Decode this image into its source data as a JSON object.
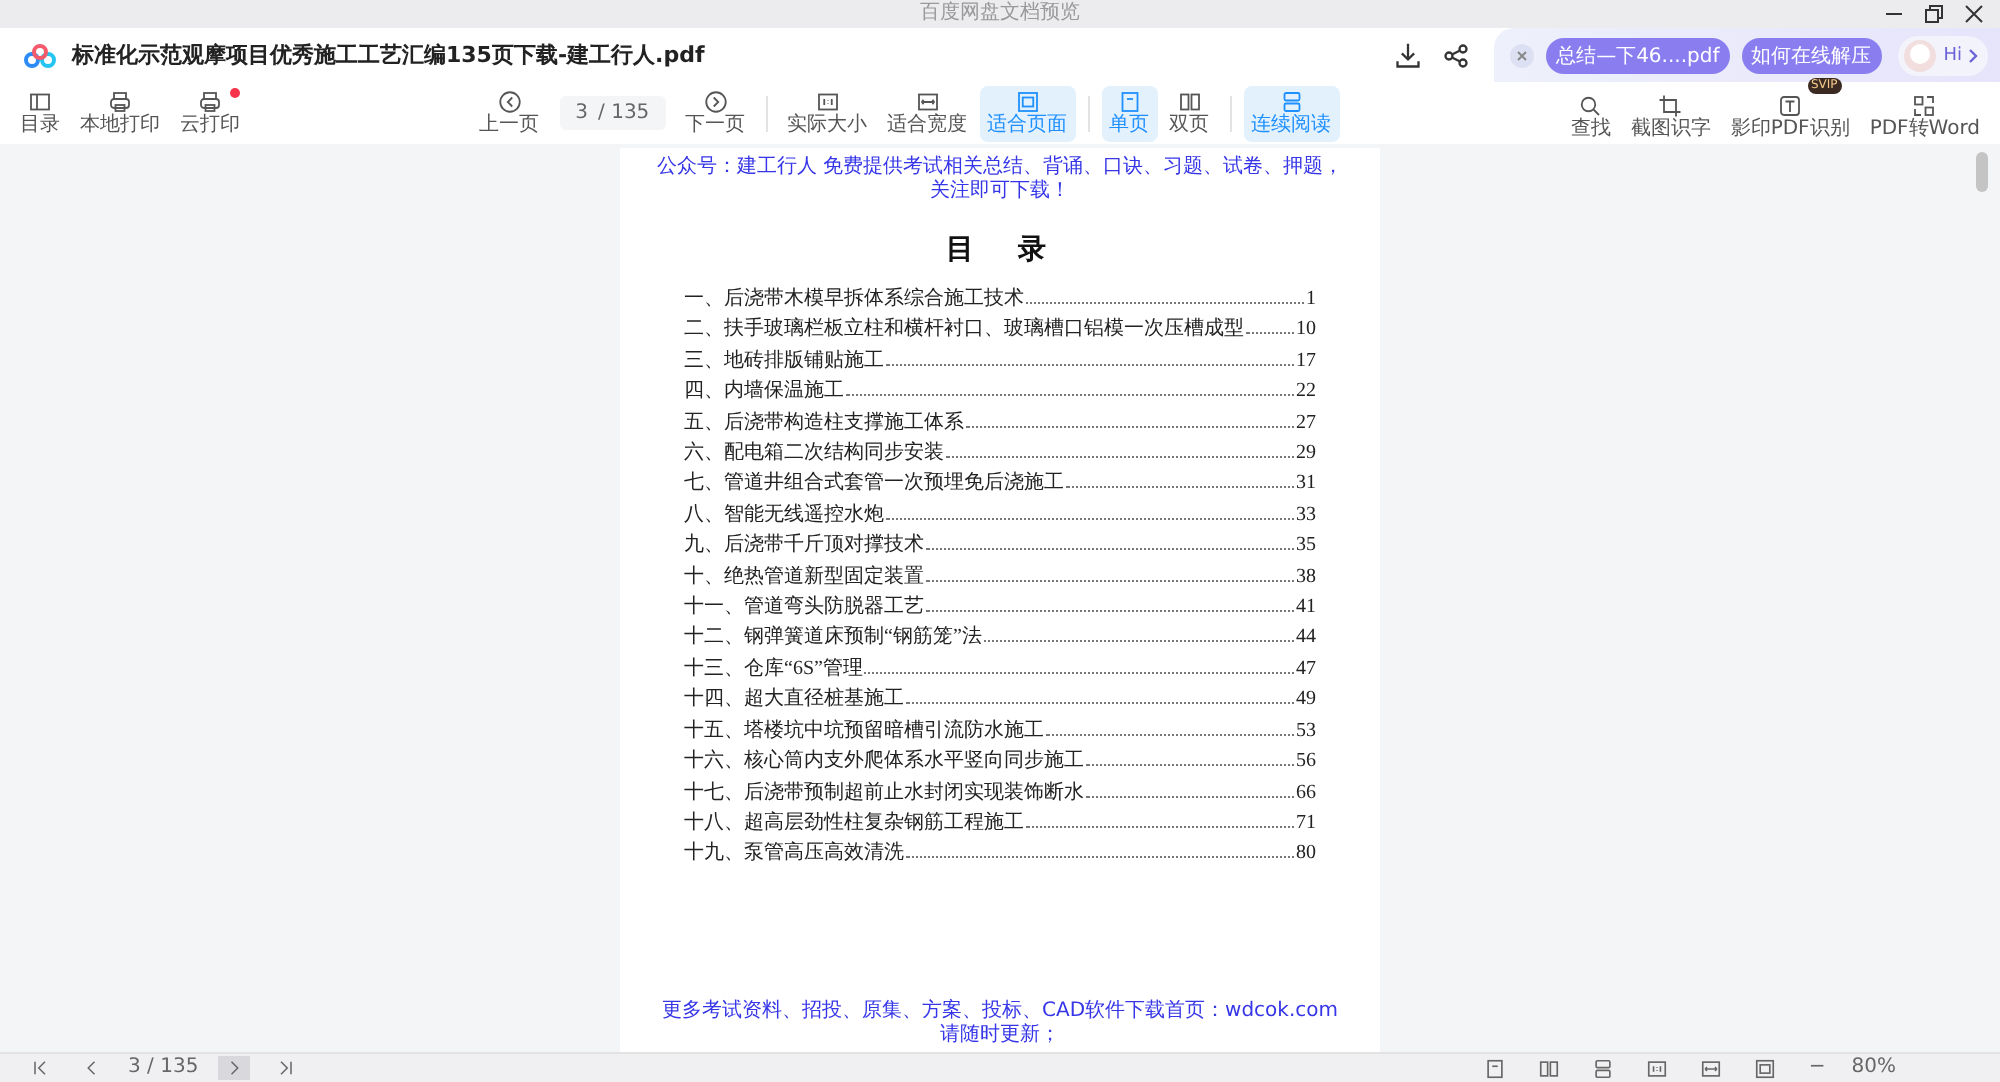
{
  "window": {
    "title": "百度网盘文档预览"
  },
  "header": {
    "file_name": "标准化示范观摩项目优秀施工工艺汇编135页下载-建工行人.pdf",
    "promo_chips": [
      "总结—下46....pdf",
      "如何在线解压"
    ],
    "assistant_greeting": "Hi"
  },
  "toolbar": {
    "left": [
      {
        "kind": "toc",
        "label": "目录",
        "dot": false
      },
      {
        "kind": "print",
        "label": "本地打印",
        "dot": false
      },
      {
        "kind": "cloud-print",
        "label": "云打印",
        "dot": true
      }
    ],
    "prev": {
      "label": "上一页"
    },
    "page_input": {
      "value": "3",
      "total": "/ 135"
    },
    "next": {
      "label": "下一页"
    },
    "view_groups": [
      [
        {
          "kind": "actual-size",
          "label": "实际大小",
          "selected": false
        },
        {
          "kind": "fit-width",
          "label": "适合宽度",
          "selected": false
        },
        {
          "kind": "fit-page",
          "label": "适合页面",
          "selected": true
        }
      ],
      [
        {
          "kind": "single",
          "label": "单页",
          "selected": true
        },
        {
          "kind": "double",
          "label": "双页",
          "selected": false
        }
      ],
      [
        {
          "kind": "continuous",
          "label": "连续阅读",
          "selected": true
        }
      ]
    ],
    "right": [
      {
        "kind": "search",
        "label": "查找"
      },
      {
        "kind": "crop",
        "label": "截图识字"
      },
      {
        "kind": "scan",
        "label": "影印PDF识别",
        "badge": "SVIP"
      },
      {
        "kind": "convert",
        "label": "PDF转Word"
      }
    ]
  },
  "document": {
    "header_note": "公众号：建工行人 免费提供考试相关总结、背诵、口诀、习题、试卷、押题，关注即可下载！",
    "toc_title": "目　录",
    "toc": [
      {
        "title": "一、后浇带木模早拆体系综合施工技术",
        "page": "1"
      },
      {
        "title": "二、扶手玻璃栏板立柱和横杆衬口、玻璃槽口铝模一次压槽成型",
        "page": "10"
      },
      {
        "title": "三、地砖排版铺贴施工",
        "page": "17"
      },
      {
        "title": "四、内墙保温施工",
        "page": "22"
      },
      {
        "title": "五、后浇带构造柱支撑施工体系",
        "page": "27"
      },
      {
        "title": "六、配电箱二次结构同步安装",
        "page": "29"
      },
      {
        "title": "七、管道井组合式套管一次预埋免后浇施工",
        "page": "31"
      },
      {
        "title": "八、智能无线遥控水炮",
        "page": "33"
      },
      {
        "title": "九、后浇带千斤顶对撑技术",
        "page": "35"
      },
      {
        "title": "十、绝热管道新型固定装置",
        "page": "38"
      },
      {
        "title": "十一、管道弯头防脱器工艺",
        "page": "41"
      },
      {
        "title": "十二、钢弹簧道床预制“钢筋笼”法",
        "page": "44"
      },
      {
        "title": "十三、仓库“6S”管理",
        "page": "47"
      },
      {
        "title": "十四、超大直径桩基施工",
        "page": "49"
      },
      {
        "title": "十五、塔楼坑中坑预留暗槽引流防水施工",
        "page": "53"
      },
      {
        "title": "十六、核心筒内支外爬体系水平竖向同步施工",
        "page": "56"
      },
      {
        "title": "十七、后浇带预制超前止水封闭实现装饰断水",
        "page": "66"
      },
      {
        "title": "十八、超高层劲性柱复杂钢筋工程施工",
        "page": "71"
      },
      {
        "title": "十九、泵管高压高效清洗",
        "page": "80"
      }
    ],
    "footer_note": "更多考试资料、招投、原集、方案、投标、CAD软件下载首页：wdcok.com 请随时更新；"
  },
  "status_bar": {
    "nav": [
      {
        "kind": "first",
        "highlighted": false
      },
      {
        "kind": "prev",
        "highlighted": false
      },
      {
        "kind": "page",
        "value": "3",
        "total": "/ 135"
      },
      {
        "kind": "next",
        "highlighted": true
      },
      {
        "kind": "last",
        "highlighted": false
      }
    ],
    "views": [
      {
        "kind": "single",
        "selected": false
      },
      {
        "kind": "double",
        "selected": false
      },
      {
        "kind": "continuous",
        "selected": false
      },
      {
        "kind": "actual-size",
        "selected": false
      },
      {
        "kind": "fit-width",
        "selected": false
      },
      {
        "kind": "fit-page",
        "selected": false
      }
    ],
    "zoom_out": "−",
    "zoom": "80%"
  }
}
